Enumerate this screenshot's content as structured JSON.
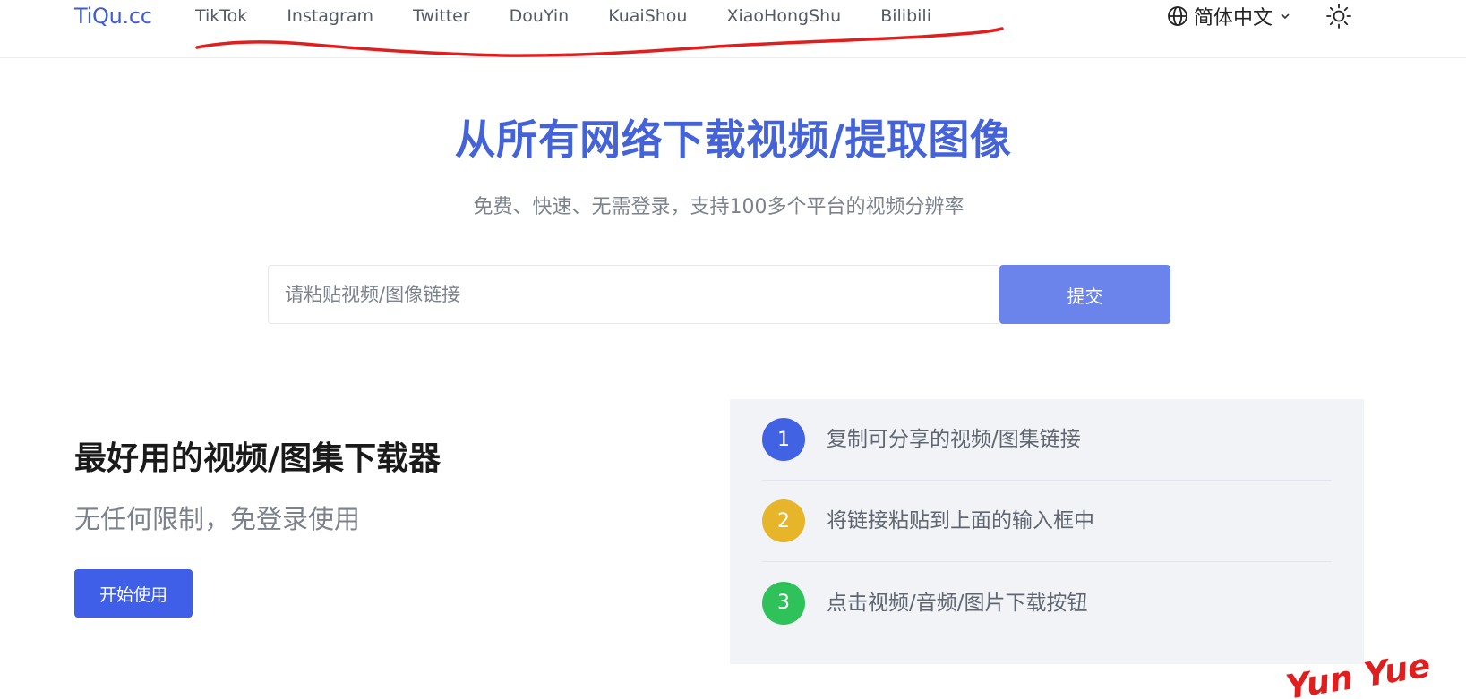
{
  "header": {
    "logo": "TiQu.cc",
    "nav": [
      "TikTok",
      "Instagram",
      "Twitter",
      "DouYin",
      "KuaiShou",
      "XiaoHongShu",
      "Bilibili"
    ],
    "language": "简体中文",
    "language_icon": "globe-icon",
    "theme_icon": "sun-icon"
  },
  "hero": {
    "title": "从所有网络下载视频/提取图像",
    "subtitle": "免费、快速、无需登录，支持100多个平台的视频分辨率",
    "input_placeholder": "请粘贴视频/图像链接",
    "submit_label": "提交"
  },
  "feature": {
    "title": "最好用的视频/图集下载器",
    "subtitle": "无任何限制，免登录使用",
    "start_label": "开始使用"
  },
  "steps": [
    {
      "num": "1",
      "text": "复制可分享的视频/图集链接",
      "color": "#4162e3"
    },
    {
      "num": "2",
      "text": "将链接粘贴到上面的输入框中",
      "color": "#e6b52a"
    },
    {
      "num": "3",
      "text": "点击视频/音频/图片下载按钮",
      "color": "#2fc25b"
    }
  ],
  "colors": {
    "brand": "#4563d8",
    "submit": "#6a84ec",
    "start": "#3f5fe8",
    "annotation": "#e01e1e"
  },
  "watermark": "Yun Yue"
}
